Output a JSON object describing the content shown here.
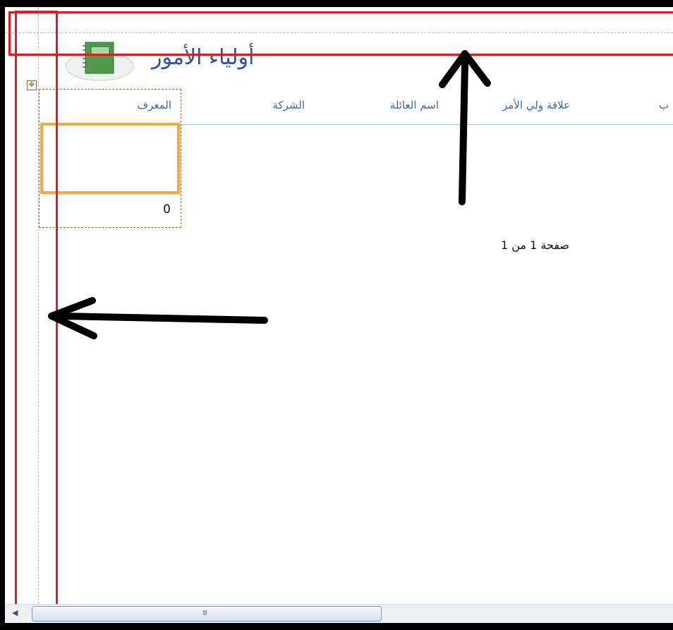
{
  "report": {
    "title": "أولياء الأمور",
    "columns": [
      "المعرف",
      "الشركة",
      "اسم العائلة",
      "علاقة ولي الأمر",
      "ب"
    ],
    "detail_value": "0",
    "page_footer": "صفحة 1 من 1"
  },
  "icons": {
    "logo": "notebook-icon",
    "move_handle": "move-handle-icon",
    "scroll_left": "scroll-left-arrow-icon",
    "scroll_grip": "scroll-grip-icon"
  },
  "annotation_colors": {
    "highlight_box": "#e11b22",
    "selected_field": "#f7a83c",
    "arrow": "#000000"
  },
  "scrollbar": {
    "grip_label": "III"
  }
}
